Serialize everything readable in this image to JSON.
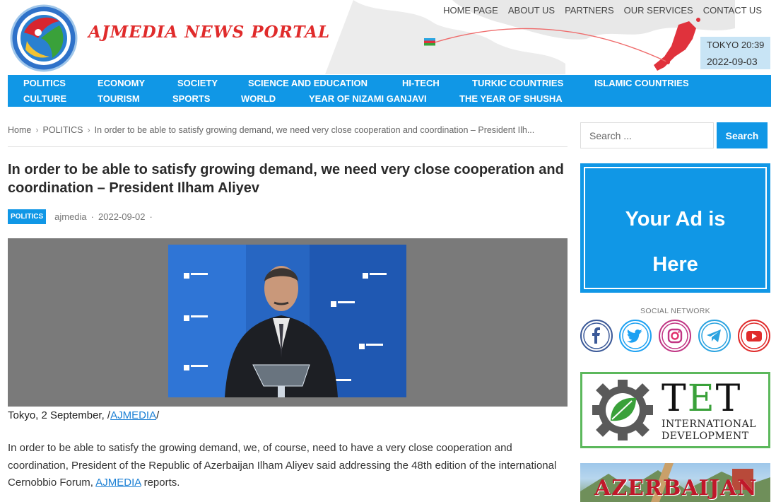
{
  "brand": {
    "title": "AJMEDIA NEWS PORTAL"
  },
  "topnav": [
    "HOME PAGE",
    "ABOUT US",
    "PARTNERS",
    "OUR SERVICES",
    "CONTACT US"
  ],
  "clock": {
    "city_time": "TOKYO 20:39",
    "date": "2022-09-03"
  },
  "mainnav": {
    "row1": [
      "POLITICS",
      "ECONOMY",
      "SOCIETY",
      "SCIENCE AND EDUCATION",
      "HI-TECH",
      "TURKIC COUNTRIES",
      "ISLAMIC COUNTRIES"
    ],
    "row2": [
      "CULTURE",
      "TOURISM",
      "SPORTS",
      "WORLD",
      "YEAR OF NIZAMI GANJAVI",
      "THE YEAR OF SHUSHA"
    ]
  },
  "breadcrumb": {
    "home": "Home",
    "category": "POLITICS",
    "current": "In order to be able to satisfy growing demand, we need very close cooperation and coordination – President Ilh..."
  },
  "article": {
    "title": "In order to be able to satisfy growing demand, we need very close cooperation and coordination – President Ilham Aliyev",
    "category": "POLITICS",
    "author": "ajmedia",
    "date": "2022-09-02",
    "dot": "·",
    "caption_prefix": "Tokyo, 2 September, /",
    "caption_link": "AJMEDIA",
    "caption_suffix": "/",
    "body_text": "In order to be able to satisfy the growing demand, we, of course, need to have a very close cooperation and coordination, President of the Republic of Azerbaijan Ilham Aliyev said addressing the 48th edition of the international Cernobbio Forum,",
    "body_link": "AJMEDIA",
    "body_suffix": " reports."
  },
  "sidebar": {
    "search_placeholder": "Search ...",
    "search_button": "Search",
    "ad_line1": "Your Ad is",
    "ad_line2": "Here",
    "social_title": "SOCIAL NETWORK",
    "tet_big": "TET",
    "tet_line1": "INTERNATIONAL",
    "tet_line2": "DEVELOPMENT",
    "banner_text": "AZERBAIJAN"
  },
  "photo_backdrop_text": "The European House Ambrosetti",
  "colors": {
    "accent": "#1097e6",
    "brand_red": "#e02b2b",
    "tet_green": "#5cb85c"
  }
}
